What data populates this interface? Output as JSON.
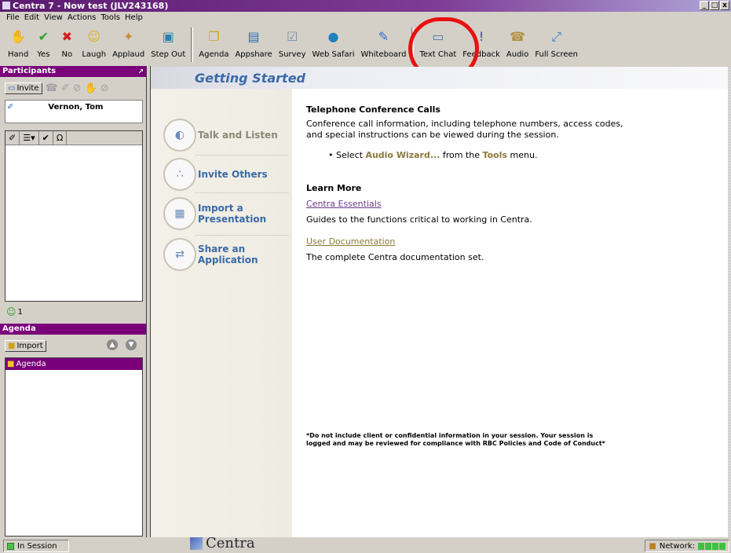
{
  "window": {
    "title": "Centra 7 - Now test (JLV243168)",
    "buttons": [
      "_",
      "□",
      "x"
    ]
  },
  "menu": [
    "File",
    "Edit",
    "View",
    "Actions",
    "Tools",
    "Help"
  ],
  "toolbar": [
    {
      "label": "Hand",
      "icon": "hand-icon",
      "glyph": "✋",
      "color": "#d08030"
    },
    {
      "label": "Yes",
      "icon": "check-icon",
      "glyph": "✔",
      "color": "#30a030"
    },
    {
      "label": "No",
      "icon": "x-icon",
      "glyph": "✖",
      "color": "#d02020"
    },
    {
      "label": "Laugh",
      "icon": "laugh-icon",
      "glyph": "☺",
      "color": "#e0b020"
    },
    {
      "label": "Applaud",
      "icon": "applaud-icon",
      "glyph": "✦",
      "color": "#c09040"
    },
    {
      "label": "Step Out",
      "icon": "door-icon",
      "glyph": "▣",
      "color": "#3080b0"
    },
    {
      "label": "Agenda",
      "icon": "agenda-icon",
      "glyph": "❐",
      "color": "#d0a020"
    },
    {
      "label": "Appshare",
      "icon": "appshare-icon",
      "glyph": "▤",
      "color": "#3070b0"
    },
    {
      "label": "Survey",
      "icon": "survey-icon",
      "glyph": "☑",
      "color": "#7090b0"
    },
    {
      "label": "Web Safari",
      "icon": "globe-icon",
      "glyph": "●",
      "color": "#2080c0"
    },
    {
      "label": "Whiteboard",
      "icon": "whiteboard-icon",
      "glyph": "✎",
      "color": "#3070c0"
    },
    {
      "label": "Text Chat",
      "icon": "chat-icon",
      "glyph": "▭",
      "color": "#4a70b0"
    },
    {
      "label": "Feedback",
      "icon": "feedback-icon",
      "glyph": "!",
      "color": "#2050c0"
    },
    {
      "label": "Audio",
      "icon": "phone-icon",
      "glyph": "☎",
      "color": "#b09040"
    },
    {
      "label": "Full Screen",
      "icon": "fullscreen-icon",
      "glyph": "⤢",
      "color": "#3080c0"
    }
  ],
  "participants": {
    "title": "Participants",
    "invite_label": "Invite",
    "list": [
      {
        "name": "Vernon, Tom"
      }
    ],
    "count": "1",
    "filter_columns": [
      "✐",
      "☰▾",
      "✔",
      "Ω"
    ]
  },
  "agenda": {
    "title": "Agenda",
    "import_label": "Import",
    "items": [
      {
        "label": "Agenda"
      }
    ]
  },
  "main": {
    "title": "Getting Started",
    "nav": [
      {
        "label": "Talk and Listen",
        "glyph": "◐"
      },
      {
        "label": "Invite Others",
        "glyph": "∴"
      },
      {
        "label": "Import a Presentation",
        "glyph": "▦"
      },
      {
        "label": "Share an Application",
        "glyph": "⇄"
      }
    ],
    "section1_title": "Telephone Conference Calls",
    "section1_body": "Conference call information, including telephone numbers, access codes, and special instructions can be viewed during the session.",
    "bullet_prefix": "Select ",
    "bullet_kw1": "Audio Wizard...",
    "bullet_mid": " from the ",
    "bullet_kw2": "Tools",
    "bullet_suffix": " menu.",
    "section2_title": "Learn More",
    "link1": "Centra Essentials",
    "link1_desc": "Guides to the functions critical to working in Centra.",
    "link2": "User Documentation",
    "link2_desc": "The complete Centra documentation set.",
    "disclaimer": "*Do not include client or confidential information in your session. Your session is logged and may be reviewed for compliance with RBC Policies and Code of Conduct*",
    "logo": "Centra"
  },
  "status": {
    "session": "In Session",
    "network": "Network:"
  }
}
